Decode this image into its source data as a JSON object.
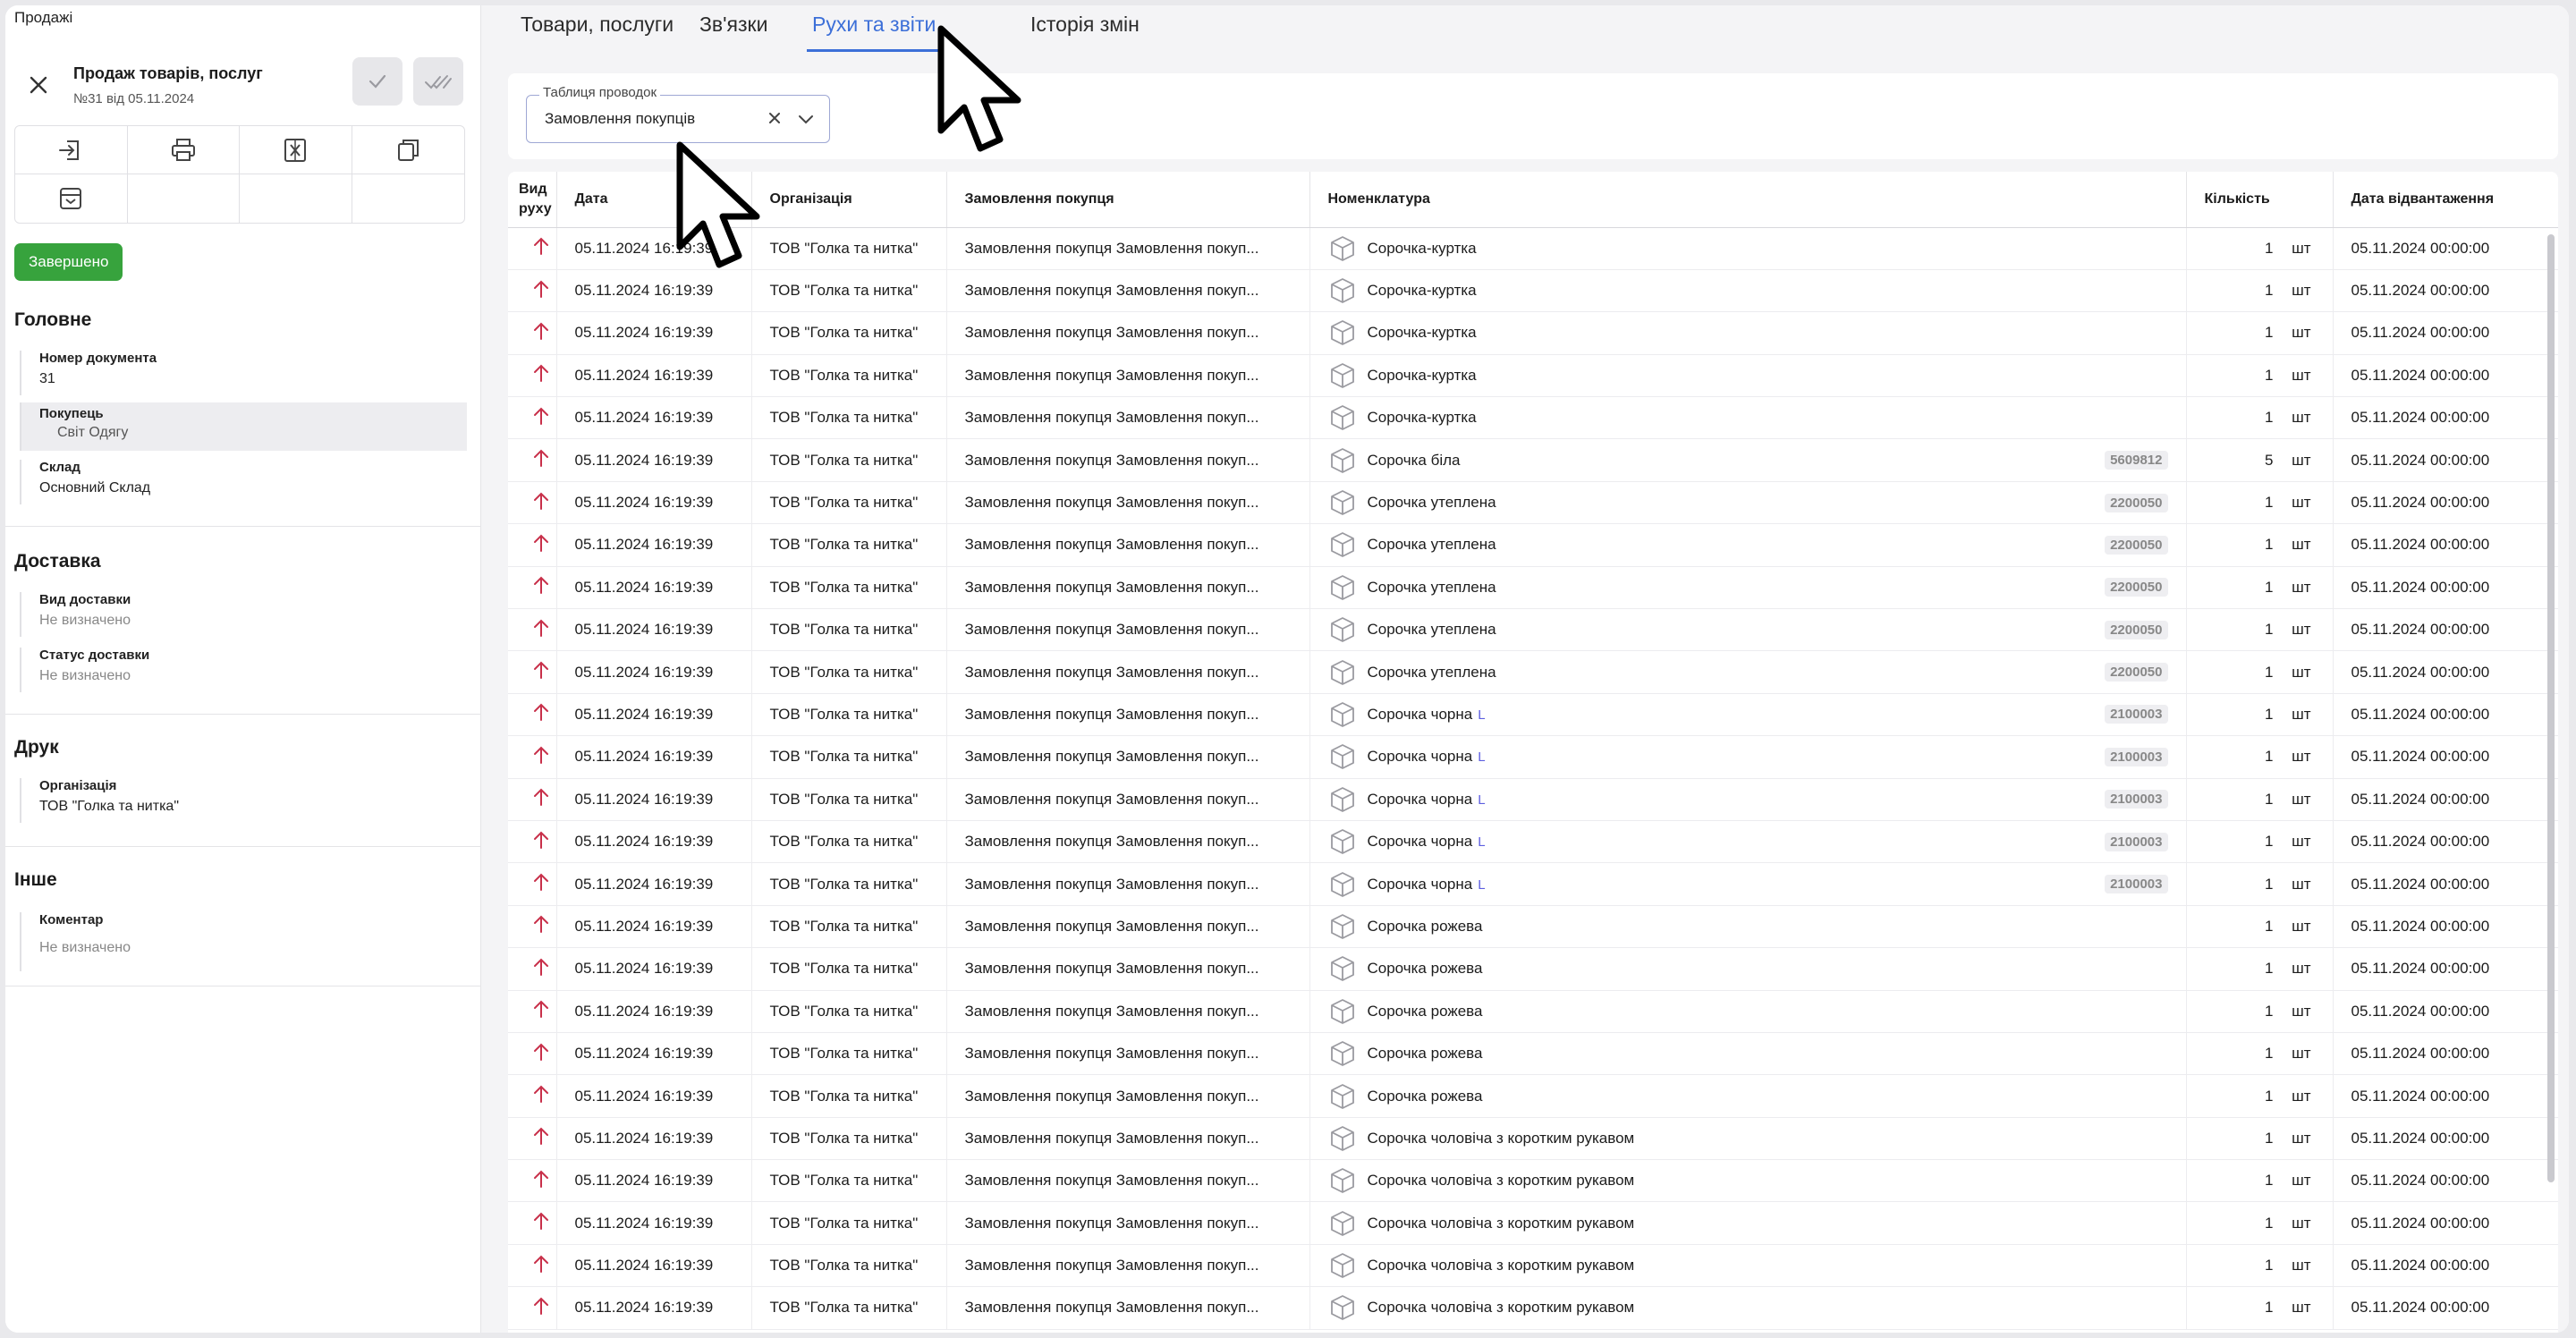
{
  "breadcrumb": "Продажі",
  "document": {
    "title": "Продаж товарів, послуг",
    "subtitle": "№31 від 05.11.2024"
  },
  "status": "Завершено",
  "sections": {
    "main": {
      "title": "Головне",
      "doc_number_label": "Номер документа",
      "doc_number_value": "31",
      "buyer_label": "Покупець",
      "buyer_value": "Світ Одягу",
      "warehouse_label": "Склад",
      "warehouse_value": "Основний Склад"
    },
    "delivery": {
      "title": "Доставка",
      "type_label": "Вид доставки",
      "type_value": "Не визначено",
      "status_label": "Статус доставки",
      "status_value": "Не визначено"
    },
    "print": {
      "title": "Друк",
      "org_label": "Організація",
      "org_value": "ТОВ \"Голка та нитка\""
    },
    "other": {
      "title": "Інше",
      "comment_label": "Коментар",
      "comment_value": "Не визначено"
    }
  },
  "tabs": [
    "Товари, послуги",
    "Зв'язки",
    "Рухи та звіти",
    "Історія змін"
  ],
  "active_tab": "Рухи та звіти",
  "filter": {
    "label": "Таблиця проводок",
    "value": "Замовлення покупців"
  },
  "table": {
    "columns": [
      "Вид руху",
      "Дата",
      "Організація",
      "Замовлення покупця",
      "Номенклатура",
      "Кількість",
      "Дата відвантаження"
    ],
    "rows": [
      {
        "date": "05.11.2024 16:19:39",
        "org": "ТОВ \"Голка та нитка\"",
        "order": "Замовлення покупця Замовлення покуп...",
        "item": "Сорочка-куртка",
        "size": "",
        "code": "",
        "qty": "1",
        "unit": "шт",
        "ship": "05.11.2024 00:00:00"
      },
      {
        "date": "05.11.2024 16:19:39",
        "org": "ТОВ \"Голка та нитка\"",
        "order": "Замовлення покупця Замовлення покуп...",
        "item": "Сорочка-куртка",
        "size": "",
        "code": "",
        "qty": "1",
        "unit": "шт",
        "ship": "05.11.2024 00:00:00"
      },
      {
        "date": "05.11.2024 16:19:39",
        "org": "ТОВ \"Голка та нитка\"",
        "order": "Замовлення покупця Замовлення покуп...",
        "item": "Сорочка-куртка",
        "size": "",
        "code": "",
        "qty": "1",
        "unit": "шт",
        "ship": "05.11.2024 00:00:00"
      },
      {
        "date": "05.11.2024 16:19:39",
        "org": "ТОВ \"Голка та нитка\"",
        "order": "Замовлення покупця Замовлення покуп...",
        "item": "Сорочка-куртка",
        "size": "",
        "code": "",
        "qty": "1",
        "unit": "шт",
        "ship": "05.11.2024 00:00:00"
      },
      {
        "date": "05.11.2024 16:19:39",
        "org": "ТОВ \"Голка та нитка\"",
        "order": "Замовлення покупця Замовлення покуп...",
        "item": "Сорочка-куртка",
        "size": "",
        "code": "",
        "qty": "1",
        "unit": "шт",
        "ship": "05.11.2024 00:00:00"
      },
      {
        "date": "05.11.2024 16:19:39",
        "org": "ТОВ \"Голка та нитка\"",
        "order": "Замовлення покупця Замовлення покуп...",
        "item": "Сорочка біла",
        "size": "",
        "code": "5609812",
        "qty": "5",
        "unit": "шт",
        "ship": "05.11.2024 00:00:00"
      },
      {
        "date": "05.11.2024 16:19:39",
        "org": "ТОВ \"Голка та нитка\"",
        "order": "Замовлення покупця Замовлення покуп...",
        "item": "Сорочка утеплена",
        "size": "",
        "code": "2200050",
        "qty": "1",
        "unit": "шт",
        "ship": "05.11.2024 00:00:00"
      },
      {
        "date": "05.11.2024 16:19:39",
        "org": "ТОВ \"Голка та нитка\"",
        "order": "Замовлення покупця Замовлення покуп...",
        "item": "Сорочка утеплена",
        "size": "",
        "code": "2200050",
        "qty": "1",
        "unit": "шт",
        "ship": "05.11.2024 00:00:00"
      },
      {
        "date": "05.11.2024 16:19:39",
        "org": "ТОВ \"Голка та нитка\"",
        "order": "Замовлення покупця Замовлення покуп...",
        "item": "Сорочка утеплена",
        "size": "",
        "code": "2200050",
        "qty": "1",
        "unit": "шт",
        "ship": "05.11.2024 00:00:00"
      },
      {
        "date": "05.11.2024 16:19:39",
        "org": "ТОВ \"Голка та нитка\"",
        "order": "Замовлення покупця Замовлення покуп...",
        "item": "Сорочка утеплена",
        "size": "",
        "code": "2200050",
        "qty": "1",
        "unit": "шт",
        "ship": "05.11.2024 00:00:00"
      },
      {
        "date": "05.11.2024 16:19:39",
        "org": "ТОВ \"Голка та нитка\"",
        "order": "Замовлення покупця Замовлення покуп...",
        "item": "Сорочка утеплена",
        "size": "",
        "code": "2200050",
        "qty": "1",
        "unit": "шт",
        "ship": "05.11.2024 00:00:00"
      },
      {
        "date": "05.11.2024 16:19:39",
        "org": "ТОВ \"Голка та нитка\"",
        "order": "Замовлення покупця Замовлення покуп...",
        "item": "Сорочка чорна",
        "size": "L",
        "code": "2100003",
        "qty": "1",
        "unit": "шт",
        "ship": "05.11.2024 00:00:00"
      },
      {
        "date": "05.11.2024 16:19:39",
        "org": "ТОВ \"Голка та нитка\"",
        "order": "Замовлення покупця Замовлення покуп...",
        "item": "Сорочка чорна",
        "size": "L",
        "code": "2100003",
        "qty": "1",
        "unit": "шт",
        "ship": "05.11.2024 00:00:00"
      },
      {
        "date": "05.11.2024 16:19:39",
        "org": "ТОВ \"Голка та нитка\"",
        "order": "Замовлення покупця Замовлення покуп...",
        "item": "Сорочка чорна",
        "size": "L",
        "code": "2100003",
        "qty": "1",
        "unit": "шт",
        "ship": "05.11.2024 00:00:00"
      },
      {
        "date": "05.11.2024 16:19:39",
        "org": "ТОВ \"Голка та нитка\"",
        "order": "Замовлення покупця Замовлення покуп...",
        "item": "Сорочка чорна",
        "size": "L",
        "code": "2100003",
        "qty": "1",
        "unit": "шт",
        "ship": "05.11.2024 00:00:00"
      },
      {
        "date": "05.11.2024 16:19:39",
        "org": "ТОВ \"Голка та нитка\"",
        "order": "Замовлення покупця Замовлення покуп...",
        "item": "Сорочка чорна",
        "size": "L",
        "code": "2100003",
        "qty": "1",
        "unit": "шт",
        "ship": "05.11.2024 00:00:00"
      },
      {
        "date": "05.11.2024 16:19:39",
        "org": "ТОВ \"Голка та нитка\"",
        "order": "Замовлення покупця Замовлення покуп...",
        "item": "Сорочка рожева",
        "size": "",
        "code": "",
        "qty": "1",
        "unit": "шт",
        "ship": "05.11.2024 00:00:00"
      },
      {
        "date": "05.11.2024 16:19:39",
        "org": "ТОВ \"Голка та нитка\"",
        "order": "Замовлення покупця Замовлення покуп...",
        "item": "Сорочка рожева",
        "size": "",
        "code": "",
        "qty": "1",
        "unit": "шт",
        "ship": "05.11.2024 00:00:00"
      },
      {
        "date": "05.11.2024 16:19:39",
        "org": "ТОВ \"Голка та нитка\"",
        "order": "Замовлення покупця Замовлення покуп...",
        "item": "Сорочка рожева",
        "size": "",
        "code": "",
        "qty": "1",
        "unit": "шт",
        "ship": "05.11.2024 00:00:00"
      },
      {
        "date": "05.11.2024 16:19:39",
        "org": "ТОВ \"Голка та нитка\"",
        "order": "Замовлення покупця Замовлення покуп...",
        "item": "Сорочка рожева",
        "size": "",
        "code": "",
        "qty": "1",
        "unit": "шт",
        "ship": "05.11.2024 00:00:00"
      },
      {
        "date": "05.11.2024 16:19:39",
        "org": "ТОВ \"Голка та нитка\"",
        "order": "Замовлення покупця Замовлення покуп...",
        "item": "Сорочка рожева",
        "size": "",
        "code": "",
        "qty": "1",
        "unit": "шт",
        "ship": "05.11.2024 00:00:00"
      },
      {
        "date": "05.11.2024 16:19:39",
        "org": "ТОВ \"Голка та нитка\"",
        "order": "Замовлення покупця Замовлення покуп...",
        "item": "Сорочка чоловіча з коротким рукавом",
        "size": "",
        "code": "",
        "qty": "1",
        "unit": "шт",
        "ship": "05.11.2024 00:00:00"
      },
      {
        "date": "05.11.2024 16:19:39",
        "org": "ТОВ \"Голка та нитка\"",
        "order": "Замовлення покупця Замовлення покуп...",
        "item": "Сорочка чоловіча з коротким рукавом",
        "size": "",
        "code": "",
        "qty": "1",
        "unit": "шт",
        "ship": "05.11.2024 00:00:00"
      },
      {
        "date": "05.11.2024 16:19:39",
        "org": "ТОВ \"Голка та нитка\"",
        "order": "Замовлення покупця Замовлення покуп...",
        "item": "Сорочка чоловіча з коротким рукавом",
        "size": "",
        "code": "",
        "qty": "1",
        "unit": "шт",
        "ship": "05.11.2024 00:00:00"
      },
      {
        "date": "05.11.2024 16:19:39",
        "org": "ТОВ \"Голка та нитка\"",
        "order": "Замовлення покупця Замовлення покуп...",
        "item": "Сорочка чоловіча з коротким рукавом",
        "size": "",
        "code": "",
        "qty": "1",
        "unit": "шт",
        "ship": "05.11.2024 00:00:00"
      },
      {
        "date": "05.11.2024 16:19:39",
        "org": "ТОВ \"Голка та нитка\"",
        "order": "Замовлення покупця Замовлення покуп...",
        "item": "Сорочка чоловіча з коротким рукавом",
        "size": "",
        "code": "",
        "qty": "1",
        "unit": "шт",
        "ship": "05.11.2024 00:00:00"
      }
    ]
  },
  "colors": {
    "accent": "#3c6fd8",
    "status_green": "#37a33d",
    "movement_arrow": "#c8304a"
  },
  "icons": {
    "close": "close-icon",
    "post": "check-icon",
    "post_close": "double-check-icon",
    "toolbar": [
      "import-icon",
      "print-icon",
      "excel-icon",
      "copy-icon",
      "archive-icon"
    ],
    "movement": "arrow-up-icon",
    "item": "box-icon",
    "cursor": "mouse-cursor-icon"
  }
}
